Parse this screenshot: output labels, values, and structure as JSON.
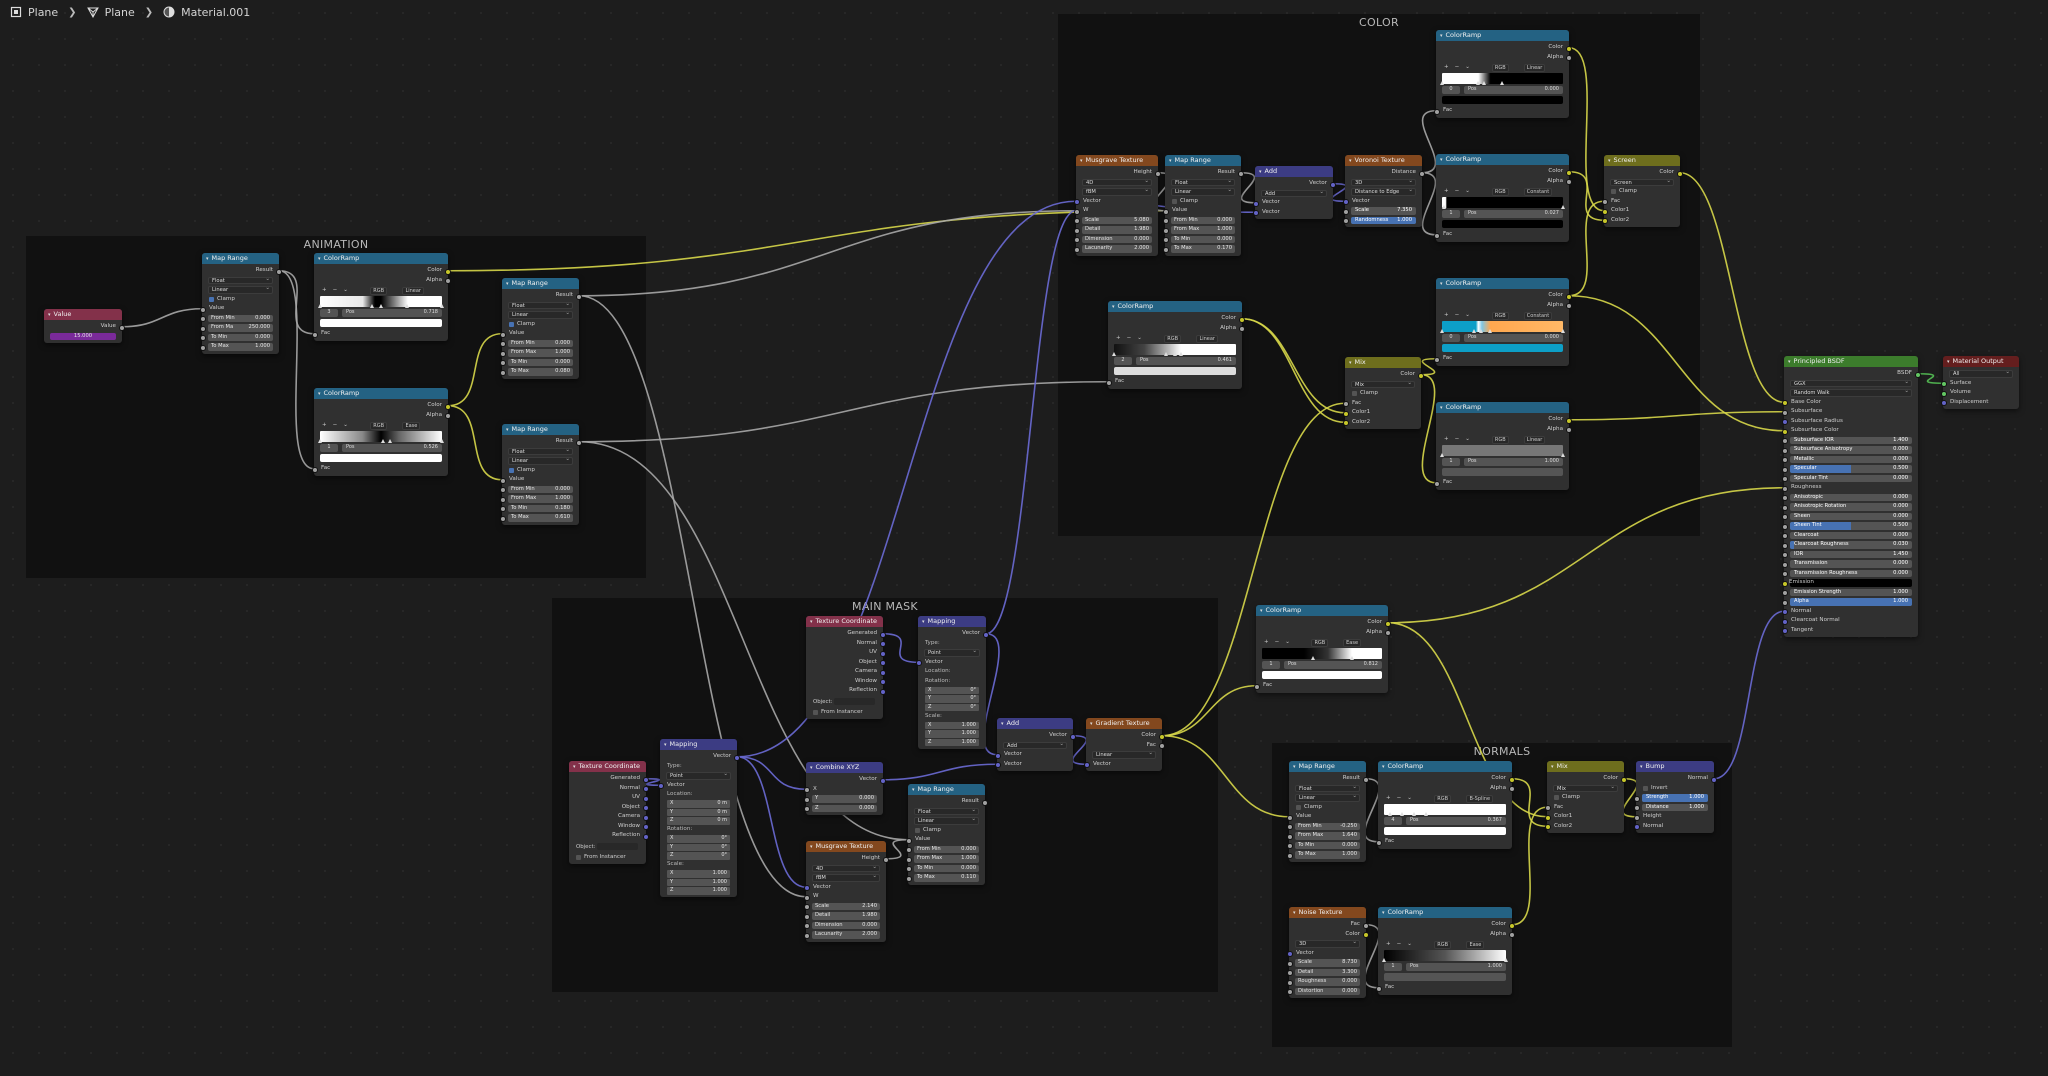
{
  "breadcrumb": [
    {
      "label": "Plane",
      "icon": "object-icon"
    },
    {
      "label": "Plane",
      "icon": "mesh-icon"
    },
    {
      "label": "Material.001",
      "icon": "material-icon"
    }
  ],
  "frames": [
    {
      "id": "animation",
      "label": "ANIMATION"
    },
    {
      "id": "color",
      "label": "COLOR"
    },
    {
      "id": "main-mask",
      "label": "MAIN MASK"
    },
    {
      "id": "normals",
      "label": "NORMALS"
    }
  ],
  "colors": {
    "header_input": "#83314a",
    "header_converter": "#246283",
    "header_vector": "#3c3c83",
    "header_texture": "#83481e",
    "header_color": "#6e6e1d",
    "header_shader": "#3c7c2c",
    "header_output": "#641e1e",
    "socket_float": "#a1a1a1",
    "socket_color": "#c7c729",
    "socket_vector": "#6363c7",
    "socket_shader": "#63c763",
    "link_float": "#a8a8a8",
    "link_color": "#d8d84a",
    "link_vector": "#6b6bd6",
    "link_shader": "#55c155"
  },
  "nodes": {
    "value_node": {
      "title": "Value",
      "out": "Value",
      "value": "15.000"
    },
    "anim_maprange": {
      "title": "Map Range",
      "out": "Result",
      "dtype": "Float",
      "interp": "Linear",
      "clamp": "Clamp",
      "value": "Value",
      "fields": [
        [
          "From Min",
          "0.000"
        ],
        [
          "From Ma",
          "250.000"
        ],
        [
          "To Min",
          "0.000"
        ],
        [
          "To Max",
          "1.000"
        ]
      ]
    },
    "anim_ramp1": {
      "title": "ColorRamp",
      "out1": "Color",
      "out2": "Alpha",
      "mode": "RGB",
      "interp": "Linear",
      "idx": "3",
      "pos_label": "Pos",
      "pos": "0.718",
      "fac": "Fac"
    },
    "anim_ramp2": {
      "title": "ColorRamp",
      "out1": "Color",
      "out2": "Alpha",
      "mode": "RGB",
      "interp": "Ease",
      "idx": "1",
      "pos_label": "Pos",
      "pos": "0.526",
      "fac": "Fac"
    },
    "anim_map2": {
      "title": "Map Range",
      "out": "Result",
      "dtype": "Float",
      "interp": "Linear",
      "clamp": "Clamp",
      "value": "Value",
      "fields": [
        [
          "From Min",
          "0.000"
        ],
        [
          "From Max",
          "1.000"
        ],
        [
          "To Min",
          "0.000"
        ],
        [
          "To Max",
          "0.080"
        ]
      ]
    },
    "anim_map3": {
      "title": "Map Range",
      "out": "Result",
      "dtype": "Float",
      "interp": "Linear",
      "clamp": "Clamp",
      "value": "Value",
      "fields": [
        [
          "From Min",
          "0.000"
        ],
        [
          "From Max",
          "1.000"
        ],
        [
          "To Min",
          "0.180"
        ],
        [
          "To Max",
          "0.610"
        ]
      ]
    },
    "mm_texcoord": {
      "title": "Texture Coordinate",
      "outs": [
        "Generated",
        "Normal",
        "UV",
        "Object",
        "Camera",
        "Window",
        "Reflection"
      ],
      "object_label": "Object:",
      "instancer": "From Instancer"
    },
    "mm_mapping": {
      "title": "Mapping",
      "out": "Vector",
      "type_label": "Type:",
      "type": "Point",
      "vector": "Vector",
      "location": "Location:",
      "loc": [
        [
          "X",
          "0 m"
        ],
        [
          "Y",
          "0 m"
        ],
        [
          "Z",
          "0 m"
        ]
      ],
      "rotation": "Rotation:",
      "rot": [
        [
          "X",
          "0°"
        ],
        [
          "Y",
          "0°"
        ],
        [
          "Z",
          "0°"
        ]
      ],
      "scale_label": "Scale:",
      "scale": [
        [
          "X",
          "1.000"
        ],
        [
          "Y",
          "1.000"
        ],
        [
          "Z",
          "1.000"
        ]
      ]
    },
    "mm_texcoord2": {
      "title": "Texture Coordinate",
      "outs": [
        "Generated",
        "Normal",
        "UV",
        "Object",
        "Camera",
        "Window",
        "Reflection"
      ],
      "object_label": "Object:",
      "instancer": "From Instancer"
    },
    "mm_mapping2": {
      "title": "Mapping",
      "out": "Vector",
      "type_label": "Type:",
      "type": "Point",
      "vector": "Vector",
      "location": "Location:",
      "rotation": "Rotation:",
      "rot": [
        [
          "X",
          "0°"
        ],
        [
          "Y",
          "0°"
        ],
        [
          "Z",
          "0°"
        ]
      ],
      "scale_label": "Scale:",
      "scale": [
        [
          "X",
          "1.000"
        ],
        [
          "Y",
          "1.000"
        ],
        [
          "Z",
          "1.000"
        ]
      ]
    },
    "mm_combine": {
      "title": "Combine XYZ",
      "out": "Vector",
      "x": "X",
      "fields": [
        [
          "Y",
          "0.000"
        ],
        [
          "Z",
          "0.000"
        ]
      ]
    },
    "mm_musgrave": {
      "title": "Musgrave Texture",
      "out": "Height",
      "dim": "4D",
      "type": "fBM",
      "vector": "Vector",
      "w": "W",
      "fields": [
        [
          "Scale",
          "2.140"
        ],
        [
          "Detail",
          "1.980"
        ],
        [
          "Dimension",
          "0.000"
        ],
        [
          "Lacunarity",
          "2.000"
        ]
      ]
    },
    "mm_maprange": {
      "title": "Map Range",
      "out": "Result",
      "dtype": "Float",
      "interp": "Linear",
      "clamp": "Clamp",
      "value": "Value",
      "fields": [
        [
          "From Min",
          "0.000"
        ],
        [
          "From Max",
          "1.000"
        ],
        [
          "To Min",
          "0.000"
        ],
        [
          "To Max",
          "0.110"
        ]
      ]
    },
    "mm_add": {
      "title": "Add",
      "out": "Vector",
      "op": "Add",
      "in1": "Vector",
      "in2": "Vector"
    },
    "mm_gradient": {
      "title": "Gradient Texture",
      "out1": "Color",
      "out2": "Fac",
      "type": "Linear",
      "vector": "Vector"
    },
    "mid_ramp": {
      "title": "ColorRamp",
      "out1": "Color",
      "out2": "Alpha",
      "mode": "RGB",
      "interp": "Ease",
      "idx": "1",
      "pos_label": "Pos",
      "pos": "0.812",
      "fac": "Fac"
    },
    "c_musgrave": {
      "title": "Musgrave Texture",
      "out": "Height",
      "dim": "4D",
      "type": "fBM",
      "vector": "Vector",
      "w": "W",
      "fields": [
        [
          "Scale",
          "5.080"
        ],
        [
          "Detail",
          "1.980"
        ],
        [
          "Dimension",
          "0.000"
        ],
        [
          "Lacunarity",
          "2.000"
        ]
      ]
    },
    "c_maprange": {
      "title": "Map Range",
      "out": "Result",
      "dtype": "Float",
      "interp": "Linear",
      "clamp": "Clamp",
      "value": "Value",
      "fields": [
        [
          "From Min",
          "0.000"
        ],
        [
          "From Max",
          "1.000"
        ],
        [
          "To Min",
          "0.000"
        ],
        [
          "To Max",
          "0.170"
        ]
      ]
    },
    "c_add": {
      "title": "Add",
      "out": "Vector",
      "op": "Add",
      "in1": "Vector",
      "in2": "Vector"
    },
    "c_voronoi": {
      "title": "Voronoi Texture",
      "out": "Distance",
      "dim": "3D",
      "feature": "Distance to Edge",
      "vector": "Vector",
      "scale_label": "Scale",
      "scale": "7.350",
      "rand_label": "Randomness",
      "rand": "1.000"
    },
    "c_ramp_mid": {
      "title": "ColorRamp",
      "out1": "Color",
      "out2": "Alpha",
      "mode": "RGB",
      "interp": "Linear",
      "idx": "2",
      "pos_label": "Pos",
      "pos": "0.461",
      "fac": "Fac"
    },
    "c_mix": {
      "title": "Mix",
      "out": "Color",
      "blend": "Mix",
      "clamp": "Clamp",
      "fac": "Fac",
      "c1": "Color1",
      "c2": "Color2"
    },
    "c_ramp_top": {
      "title": "ColorRamp",
      "out1": "Color",
      "out2": "Alpha",
      "mode": "RGB",
      "interp": "Linear",
      "idx": "0",
      "pos_label": "Pos",
      "pos": "0.000",
      "fac": "Fac"
    },
    "c_ramp2": {
      "title": "ColorRamp",
      "out1": "Color",
      "out2": "Alpha",
      "mode": "RGB",
      "interp": "Constant",
      "idx": "1",
      "pos_label": "Pos",
      "pos": "0.027",
      "fac": "Fac"
    },
    "c_ramp3": {
      "title": "ColorRamp",
      "out1": "Color",
      "out2": "Alpha",
      "mode": "RGB",
      "interp": "Constant",
      "idx": "0",
      "pos_label": "Pos",
      "pos": "0.000",
      "fac": "Fac"
    },
    "c_ramp4": {
      "title": "ColorRamp",
      "out1": "Color",
      "out2": "Alpha",
      "mode": "RGB",
      "interp": "Linear",
      "idx": "1",
      "pos_label": "Pos",
      "pos": "1.000",
      "fac": "Fac"
    },
    "c_screen": {
      "title": "Screen",
      "out": "Color",
      "blend": "Screen",
      "clamp": "Clamp",
      "fac": "Fac",
      "c1": "Color1",
      "c2": "Color2"
    },
    "n_maprange": {
      "title": "Map Range",
      "out": "Result",
      "dtype": "Float",
      "interp": "Linear",
      "clamp": "Clamp",
      "value": "Value",
      "fields": [
        [
          "From Min",
          "-0.250"
        ],
        [
          "From Max",
          "1.640"
        ],
        [
          "To Min",
          "0.000"
        ],
        [
          "To Max",
          "1.000"
        ]
      ]
    },
    "n_ramp1": {
      "title": "ColorRamp",
      "out1": "Color",
      "out2": "Alpha",
      "mode": "RGB",
      "interp": "B-Spline",
      "idx": "4",
      "pos_label": "Pos",
      "pos": "0.367",
      "fac": "Fac"
    },
    "n_mix": {
      "title": "Mix",
      "out": "Color",
      "blend": "Mix",
      "clamp": "Clamp",
      "fac": "Fac",
      "c1": "Color1",
      "c2": "Color2"
    },
    "n_bump": {
      "title": "Bump",
      "out": "Normal",
      "invert": "Invert",
      "strength_label": "Strength",
      "strength": "1.000",
      "distance_label": "Distance",
      "distance": "1.000",
      "height": "Height",
      "normal": "Normal"
    },
    "n_noise": {
      "title": "Noise Texture",
      "out1": "Fac",
      "out2": "Color",
      "dim": "3D",
      "vector": "Vector",
      "fields": [
        [
          "Scale",
          "8.730"
        ],
        [
          "Detail",
          "3.300"
        ],
        [
          "Roughness",
          "0.000"
        ],
        [
          "Distortion",
          "0.000"
        ]
      ]
    },
    "n_ramp2": {
      "title": "ColorRamp",
      "out1": "Color",
      "out2": "Alpha",
      "mode": "RGB",
      "interp": "Ease",
      "idx": "1",
      "pos_label": "Pos",
      "pos": "1.000",
      "fac": "Fac"
    },
    "bsdf": {
      "title": "Principled BSDF",
      "out": "BSDF",
      "dist": "GGX",
      "sss": "Random Walk",
      "inputs1": [
        "Base Color",
        "Subsurface",
        "Subsurface Radius",
        "Subsurface Color"
      ],
      "fields": [
        [
          "Subsurface IOR",
          "1.400",
          0
        ],
        [
          "Subsurface Anisotropy",
          "0.000",
          0
        ],
        [
          "Metallic",
          "0.000",
          0
        ],
        [
          "Specular",
          "0.500",
          0.5
        ],
        [
          "Specular Tint",
          "0.000",
          0
        ]
      ],
      "roughness": "Roughness",
      "fields2": [
        [
          "Anisotropic",
          "0.000",
          0
        ],
        [
          "Anisotropic Rotation",
          "0.000",
          0
        ],
        [
          "Sheen",
          "0.000",
          0
        ],
        [
          "Sheen Tint",
          "0.500",
          0.5
        ],
        [
          "Clearcoat",
          "0.000",
          0
        ],
        [
          "Clearcoat Roughness",
          "0.030",
          0.03
        ],
        [
          "IOR",
          "1.450",
          0
        ],
        [
          "Transmission",
          "0.000",
          0
        ],
        [
          "Transmission Roughness",
          "0.000",
          0
        ]
      ],
      "emission": "Emission",
      "fields3": [
        [
          "Emission Strength",
          "1.000",
          0
        ],
        [
          "Alpha",
          "1.000",
          1
        ]
      ],
      "inputs2": [
        "Normal",
        "Clearcoat Normal",
        "Tangent"
      ]
    },
    "matout": {
      "title": "Material Output",
      "target": "All",
      "inputs": [
        "Surface",
        "Volume",
        "Displacement"
      ]
    }
  }
}
